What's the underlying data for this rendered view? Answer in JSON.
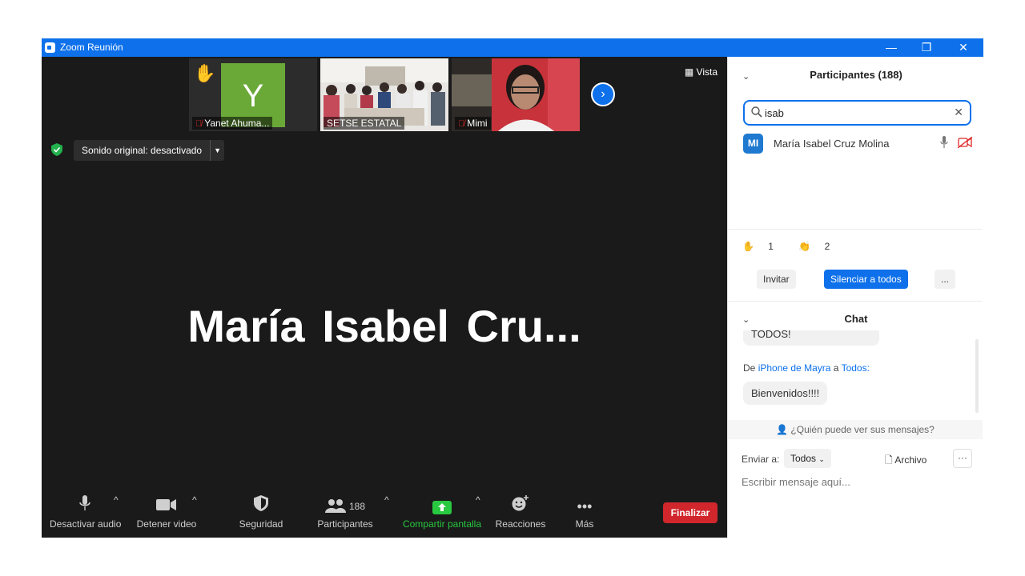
{
  "window": {
    "title": "Zoom Reunión",
    "controls": [
      "—",
      "❐",
      "✕"
    ]
  },
  "video": {
    "thumbnails": [
      {
        "name": "Yanet Ahuma...",
        "initial": "Y",
        "muted": true,
        "hand_raised": true
      },
      {
        "name": "SETSE ESTATAL",
        "muted": false
      },
      {
        "name": "Mimi",
        "muted": true
      }
    ],
    "view_label": "Vista",
    "sound_button": "Sonido original: desactivado",
    "active_speaker": "María Isabel Cru...",
    "colors": {
      "accent": "#0e71eb",
      "share": "#28c840",
      "end": "#d1272c"
    }
  },
  "toolbar": {
    "mute": "Desactivar audio",
    "video": "Detener video",
    "security": "Seguridad",
    "participants": "Participantes",
    "participant_count": "188",
    "share": "Compartir pantalla",
    "reactions": "Reacciones",
    "more": "Más",
    "end": "Finalizar"
  },
  "participants_panel": {
    "title": "Participantes (188)",
    "search_value": "isab",
    "results": [
      {
        "initials": "MI",
        "name": "María Isabel Cruz Molina",
        "mic": "unmuted",
        "video": "off"
      }
    ],
    "reactions": [
      {
        "icon": "raised-hand",
        "count": "1"
      },
      {
        "icon": "clapping",
        "count": "2"
      }
    ],
    "invite": "Invitar",
    "mute_all": "Silenciar a todos",
    "more": "..."
  },
  "chat": {
    "title": "Chat",
    "partial_message": "TODOS!",
    "sender_prefix": "De",
    "sender": "iPhone de Mayra",
    "to_word": "a",
    "recipient": "Todos:",
    "message": "Bienvenidos!!!!",
    "who_can_see": "¿Quién puede ver sus mensajes?",
    "send_to_label": "Enviar a:",
    "send_to_value": "Todos",
    "file_label": "Archivo",
    "more": "···",
    "compose_placeholder": "Escribir mensaje aquí..."
  }
}
